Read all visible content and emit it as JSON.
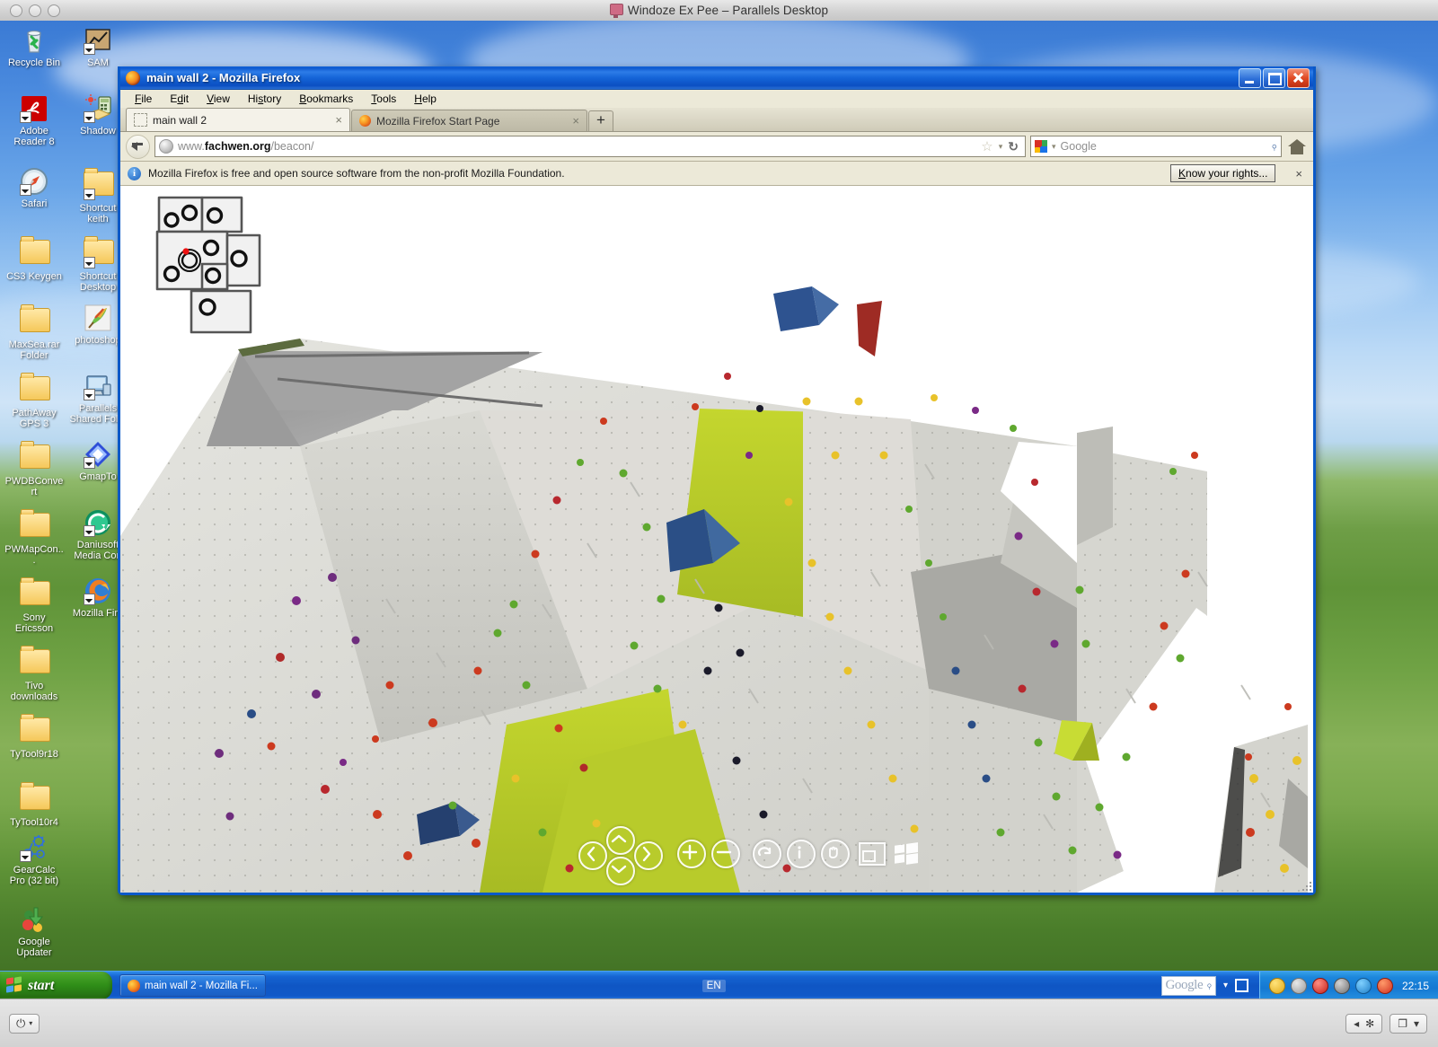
{
  "host": {
    "title": "Windoze Ex Pee – Parallels Desktop",
    "traffic_lights": [
      "close",
      "minimize",
      "zoom"
    ],
    "bottom_bar": {
      "power_glyph": "⏻",
      "caret_glyph": "▾",
      "left_glyph": "◂",
      "gear_glyph": "✻",
      "windows_glyph": "❐",
      "dropdown_glyph": "▾"
    }
  },
  "desktop": {
    "icons": [
      {
        "label": "Recycle Bin",
        "icon": "recycle-bin-icon",
        "shortcut": false
      },
      {
        "label": "SAM",
        "icon": "sam-chart-icon",
        "shortcut": true
      },
      {
        "label": "Adobe Reader 8",
        "icon": "adobe-reader-icon",
        "shortcut": true
      },
      {
        "label": "Shadow",
        "icon": "shadow-icon",
        "shortcut": true
      },
      {
        "label": "Safari",
        "icon": "safari-compass-icon",
        "shortcut": true
      },
      {
        "label": "Shortcut keith",
        "icon": "folder-icon",
        "shortcut": true
      },
      {
        "label": "CS3 Keygen",
        "icon": "folder-icon",
        "shortcut": false
      },
      {
        "label": "Shortcut Desktop",
        "icon": "folder-icon",
        "shortcut": true
      },
      {
        "label": "MaxSea.rar Folder",
        "icon": "folder-icon",
        "shortcut": false
      },
      {
        "label": "photoshop",
        "icon": "photoshop-feather-icon",
        "shortcut": false
      },
      {
        "label": "PathAway GPS 3",
        "icon": "folder-icon",
        "shortcut": false
      },
      {
        "label": "Parallels Shared Fol...",
        "icon": "parallels-monitor-icon",
        "shortcut": true
      },
      {
        "label": "PWDBConvert",
        "icon": "folder-icon",
        "shortcut": false
      },
      {
        "label": "GmapTo",
        "icon": "gmapto-diamond-icon",
        "shortcut": true
      },
      {
        "label": "PWMapCon...",
        "icon": "folder-icon",
        "shortcut": false
      },
      {
        "label": "Daniusoft Media Con",
        "icon": "daniusoft-icon",
        "shortcut": true
      },
      {
        "label": "Sony Ericsson",
        "icon": "folder-icon",
        "shortcut": false
      },
      {
        "label": "Mozilla Fire",
        "icon": "firefox-icon",
        "shortcut": true
      },
      {
        "label": "Tivo downloads",
        "icon": "folder-icon",
        "shortcut": false
      },
      {
        "label": "TyTool9r18",
        "icon": "folder-icon",
        "shortcut": false
      },
      {
        "label": "TyTool10r4",
        "icon": "folder-icon",
        "shortcut": false
      },
      {
        "label": "GearCalc Pro (32 bit)",
        "icon": "gearcalc-icon",
        "shortcut": true
      },
      {
        "label": "Google Updater",
        "icon": "google-updater-icon",
        "shortcut": false
      }
    ]
  },
  "firefox": {
    "window_title": "main wall 2 - Mozilla Firefox",
    "window_buttons": {
      "minimize": "Minimize",
      "maximize": "Maximize",
      "close": "Close"
    },
    "menubar": [
      "File",
      "Edit",
      "View",
      "History",
      "Bookmarks",
      "Tools",
      "Help"
    ],
    "tabs": [
      {
        "label": "main wall 2",
        "active": true,
        "favicon": "blank-favicon",
        "close": "×"
      },
      {
        "label": "Mozilla Firefox Start Page",
        "active": false,
        "favicon": "firefox-favicon",
        "close": "×"
      }
    ],
    "new_tab_label": "+",
    "urlbar": {
      "prefix": "www.",
      "domain": "fachwen.org",
      "path": "/beacon/",
      "full": "www.fachwen.org/beacon/",
      "star_glyph": "☆",
      "caret_glyph": "▾",
      "reload_glyph": "↻"
    },
    "searchbar": {
      "engine": "Google",
      "placeholder": "Google",
      "magnifier": "⌕"
    },
    "home_tooltip": "Home",
    "notification": {
      "text": "Mozilla Firefox is free and open source software from the non-profit Mozilla Foundation.",
      "button_underline": "K",
      "button_rest": "now your rights...",
      "button_label": "Know your rights...",
      "close_glyph": "×"
    }
  },
  "page": {
    "minimap": {
      "name": "wall-plan-minimap",
      "current_marker": "red-dot",
      "viewpoints": 7
    },
    "panorama": {
      "alt": "climbing wall panorama - main wall 2",
      "accent_green": "#b5cc29",
      "wall_grey": "#d9d9d4",
      "dark_grey": "#8f8f8f"
    },
    "controls": [
      {
        "name": "pan-left-button",
        "glyph": "‹"
      },
      {
        "name": "pan-up-button",
        "glyph": "^"
      },
      {
        "name": "pan-right-button",
        "glyph": "›"
      },
      {
        "name": "pan-down-button",
        "glyph": "v"
      },
      {
        "name": "zoom-in-button",
        "glyph": "+"
      },
      {
        "name": "zoom-out-button",
        "glyph": "−"
      },
      {
        "name": "autorotate-button",
        "glyph": "↻"
      },
      {
        "name": "info-button",
        "glyph": "i"
      },
      {
        "name": "pan-hand-button",
        "glyph": "✋"
      },
      {
        "name": "fullscreen-button",
        "glyph": "⧉"
      },
      {
        "name": "windows-logo-button",
        "glyph": "⊞"
      }
    ]
  },
  "taskbar": {
    "start_label": "start",
    "tasks": [
      {
        "label": "main wall 2 - Mozilla Fi...",
        "icon": "firefox-icon",
        "active": true
      }
    ],
    "language": "EN",
    "google_box": {
      "text": "Google",
      "magnifier": "⌕"
    },
    "caret_glyph": "▾",
    "clock": "22:15",
    "tray_icons": [
      "security-shield-icon",
      "antivirus-icon",
      "red-shield-alert-icon",
      "volume-icon",
      "network-error-icon",
      "opera-icon"
    ]
  }
}
